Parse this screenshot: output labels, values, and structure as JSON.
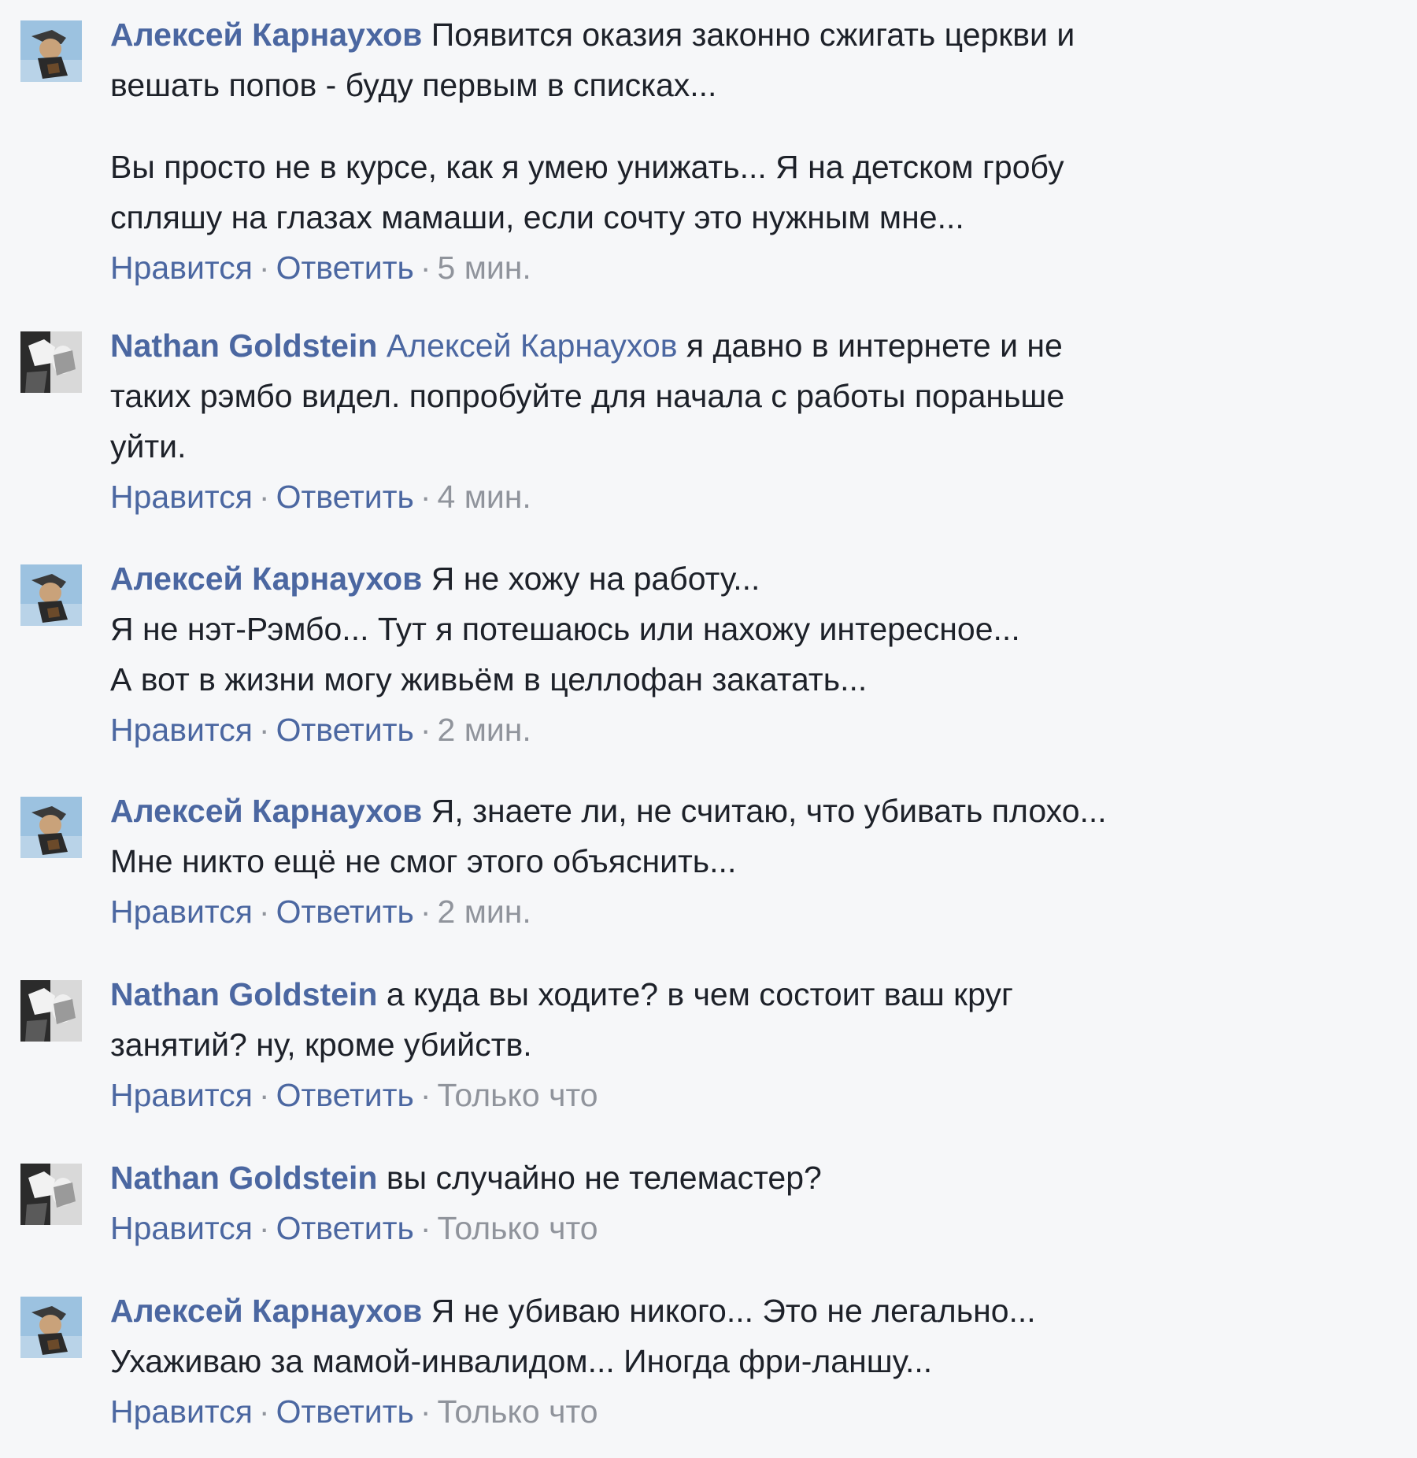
{
  "separator": "·",
  "comments": [
    {
      "author": "Алексей Карнаухов",
      "avatar_icon": "profile-photo-icon",
      "paragraphs": [
        [
          "Появится оказия законно сжигать церкви и",
          "вешать попов - буду первым в списках..."
        ],
        [
          "Вы просто не в курсе, как я умею унижать... Я на детском гробу",
          "спляшу на глазах мамаши, если сочту это нужным мне..."
        ]
      ],
      "like": "Нравится",
      "reply": "Ответить",
      "time": "5 мин."
    },
    {
      "author": "Nathan Goldstein",
      "avatar_icon": "profile-photo-icon",
      "mention": "Алексей Карнаухов",
      "paragraphs": [
        [
          "я давно в интернете и не",
          "таких рэмбо видел. попробуйте для начала с работы пораньше",
          "уйти."
        ]
      ],
      "like": "Нравится",
      "reply": "Ответить",
      "time": "4 мин."
    },
    {
      "author": "Алексей Карнаухов",
      "avatar_icon": "profile-photo-icon",
      "paragraphs": [
        [
          "Я не хожу на работу...",
          "Я не нэт-Рэмбо... Тут я потешаюсь или нахожу интересное...",
          "А вот в жизни могу живьём в целлофан закатать..."
        ]
      ],
      "like": "Нравится",
      "reply": "Ответить",
      "time": "2 мин."
    },
    {
      "author": "Алексей Карнаухов",
      "avatar_icon": "profile-photo-icon",
      "paragraphs": [
        [
          "Я, знаете ли, не считаю, что убивать плохо...",
          "Мне никто ещё не смог этого объяснить..."
        ]
      ],
      "like": "Нравится",
      "reply": "Ответить",
      "time": "2 мин."
    },
    {
      "author": "Nathan Goldstein",
      "avatar_icon": "profile-photo-icon",
      "paragraphs": [
        [
          "а куда вы ходите? в чем состоит ваш круг",
          "занятий? ну, кроме убийств."
        ]
      ],
      "like": "Нравится",
      "reply": "Ответить",
      "time": "Только что"
    },
    {
      "author": "Nathan Goldstein",
      "avatar_icon": "profile-photo-icon",
      "paragraphs": [
        [
          "вы случайно не телемастер?"
        ]
      ],
      "like": "Нравится",
      "reply": "Ответить",
      "time": "Только что"
    },
    {
      "author": "Алексей Карнаухов",
      "avatar_icon": "profile-photo-icon",
      "paragraphs": [
        [
          "Я не убиваю никого... Это не легально...",
          "Ухаживаю за мамой-инвалидом... Иногда фри-ланшу..."
        ]
      ],
      "like": "Нравится",
      "reply": "Ответить",
      "time": "Только что"
    }
  ]
}
